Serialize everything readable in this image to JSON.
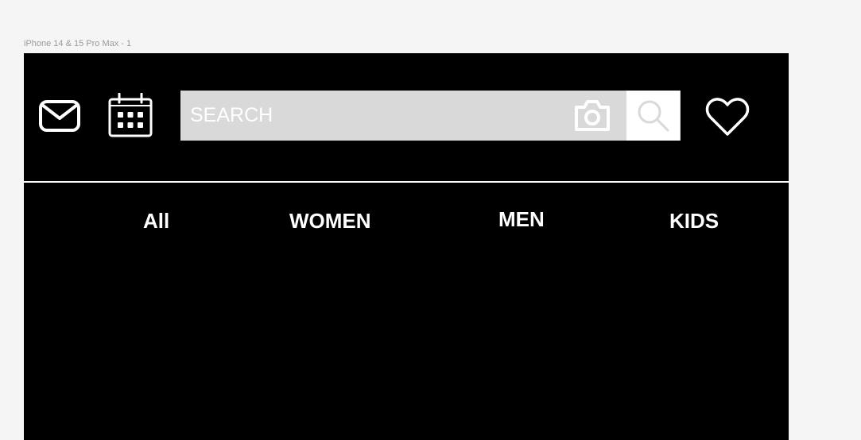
{
  "frame": {
    "label": "iPhone 14 & 15 Pro Max - 1"
  },
  "header": {
    "icons": {
      "mail": "mail-icon",
      "calendar": "calendar-icon",
      "camera": "camera-icon",
      "search": "search-icon",
      "favorites": "heart-icon"
    },
    "search": {
      "placeholder": "SEARCH",
      "value": ""
    }
  },
  "tabs": [
    {
      "label": "All"
    },
    {
      "label": "WOMEN"
    },
    {
      "label": "MEN"
    },
    {
      "label": "KIDS"
    }
  ],
  "colors": {
    "background": "#000000",
    "search_bar": "#d9d9d9",
    "search_button": "#ffffff",
    "text": "#ffffff"
  }
}
